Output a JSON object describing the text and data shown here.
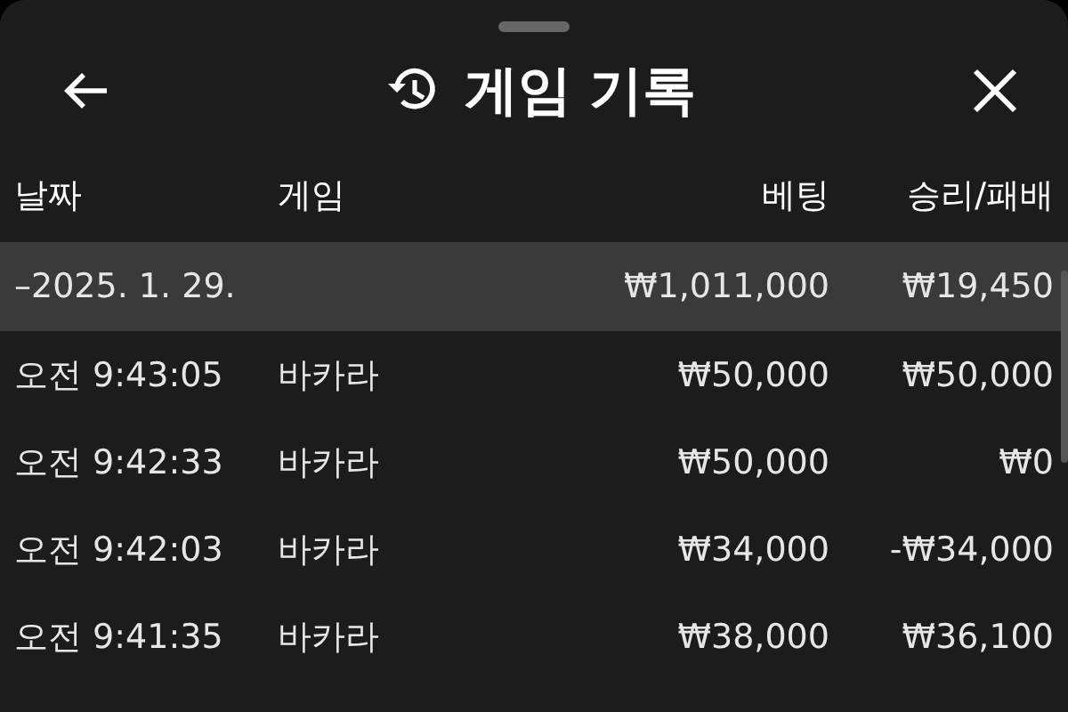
{
  "header": {
    "title": "게임 기록"
  },
  "columns": [
    "날짜",
    "게임",
    "베팅",
    "승리/패배"
  ],
  "group": {
    "date": "–2025. 1. 29.",
    "bet": "₩1,011,000",
    "result": "₩19,450",
    "selected": true
  },
  "rows": [
    {
      "time": "오전 9:43:05",
      "game": "바카라",
      "bet": "₩50,000",
      "result": "₩50,000"
    },
    {
      "time": "오전 9:42:33",
      "game": "바카라",
      "bet": "₩50,000",
      "result": "₩0"
    },
    {
      "time": "오전 9:42:03",
      "game": "바카라",
      "bet": "₩34,000",
      "result": "-₩34,000"
    },
    {
      "time": "오전 9:41:35",
      "game": "바카라",
      "bet": "₩38,000",
      "result": "₩36,100"
    }
  ]
}
